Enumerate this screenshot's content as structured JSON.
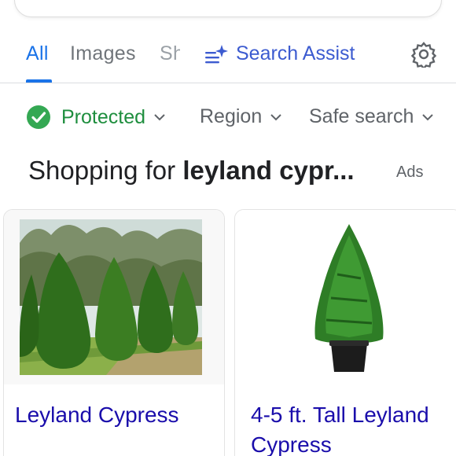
{
  "tabs": [
    {
      "label": "All",
      "active": true
    },
    {
      "label": "Images",
      "active": false
    },
    {
      "label": "Sh",
      "active": false
    }
  ],
  "search_assist": {
    "label": "Search Assist",
    "icon": "sparkle-lines-icon"
  },
  "settings": {
    "icon": "gear-icon"
  },
  "filters": {
    "protected": {
      "label": "Protected",
      "icon": "green-check-icon"
    },
    "region": {
      "label": "Region"
    },
    "safe_search": {
      "label": "Safe search"
    }
  },
  "shopping": {
    "prefix": "Shopping for ",
    "query": "leyland cypr...",
    "ads_label": "Ads"
  },
  "products": [
    {
      "title": "Leyland Cypress",
      "image": "row-of-leyland-cypress-trees"
    },
    {
      "title": "4-5 ft. Tall Leyland Cypress",
      "image": "potted-leyland-cypress"
    }
  ],
  "colors": {
    "accent": "#1a73e8",
    "assist": "#3c5bd0",
    "protected": "#1e8e3e",
    "link": "#1a0dab"
  }
}
